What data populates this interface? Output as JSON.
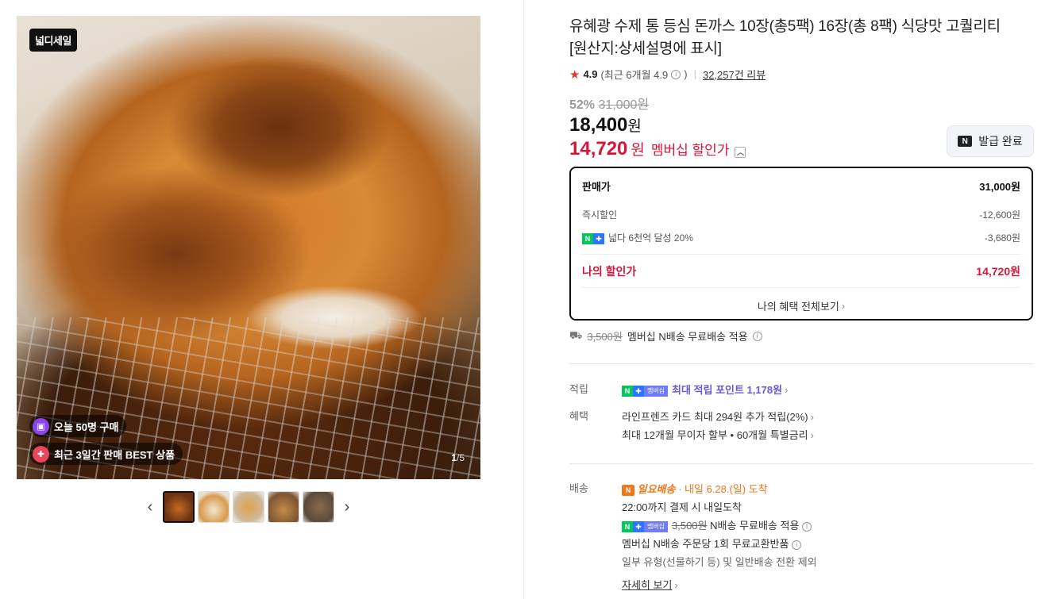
{
  "gallery": {
    "logo_badge": "넓디세일",
    "pill_buy": "오늘 50명 구매",
    "pill_best": "최근 3일간 판매 BEST 상품",
    "counter_current": "1",
    "counter_total": "/5"
  },
  "product": {
    "title": "유혜광 수제 통 등심 돈까스 10장(총5팩) 16장(총 8팩) 식당맛 고퀄리티 [원산지:상세설명에 표시]",
    "rating": "4.9",
    "rating_recent": "(최근 6개월 4.9",
    "rating_close": ")",
    "reviews": "32,257건 리뷰",
    "discount": "52%",
    "original_price": "31,000원",
    "price": "18,400",
    "price_unit": "원",
    "member_price": "14,720",
    "member_unit": "원",
    "member_label": "멤버십 할인가",
    "coupon": "발급 완료"
  },
  "breakdown": {
    "sale_label": "판매가",
    "sale_value": "31,000원",
    "instant_label": "즉시할인",
    "instant_value": "-12,600원",
    "npay_label": "넓다 6천억 달성 20%",
    "npay_value": "-3,680원",
    "my_label": "나의 할인가",
    "my_value": "14,720원",
    "more": "나의 혜택 전체보기"
  },
  "shipping_top": {
    "struck": "3,500원",
    "text": "멤버십 N배송 무료배송 적용"
  },
  "points": {
    "label": "적립",
    "text": "최대 적립 포인트 1,178원"
  },
  "benefits": {
    "label": "혜택",
    "line1": "라인프렌즈 카드 최대 294원 추가 적립(2%)",
    "line2": "최대 12개월 무이자 할부 • 60개월 특별금리"
  },
  "delivery": {
    "label": "배송",
    "badge": "일요배송",
    "date": "· 내일 6.28.(일) 도착",
    "line2": "22:00까지 결제 시 내일도착",
    "struck": "3,500원",
    "line3": "N배송 무료배송 적용",
    "line4": "멤버십 N배송 주문당 1회 무료교환반품",
    "line5": "일부 유형(선물하기 등) 및 일반배송 전환 제외",
    "more": "자세히 보기"
  },
  "colors": {
    "accent_red": "#d8143a",
    "npay_green": "#03c75a",
    "purple": "#6a5acd",
    "orange": "#f2761a"
  }
}
